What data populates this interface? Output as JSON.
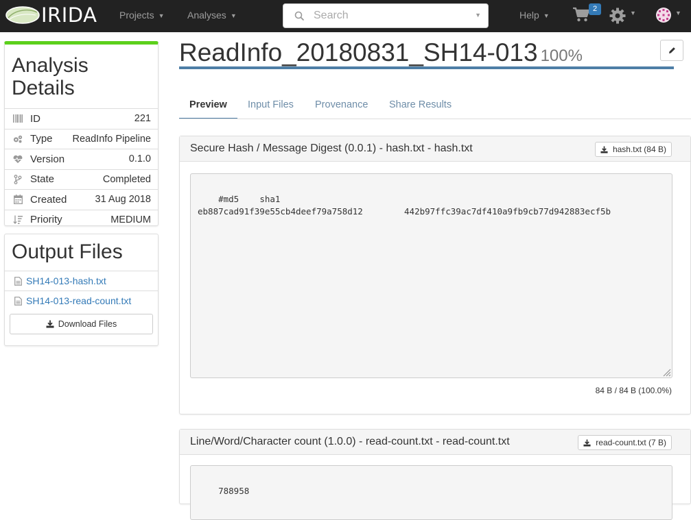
{
  "navbar": {
    "brand": "IRIDA",
    "projects": "Projects",
    "analyses": "Analyses",
    "search_placeholder": "Search",
    "help": "Help",
    "cart_count": "2"
  },
  "details": {
    "title": "Analysis Details",
    "rows": [
      {
        "icon": "barcode-icon",
        "key": "ID",
        "value": "221"
      },
      {
        "icon": "cogs-icon",
        "key": "Type",
        "value": "ReadInfo Pipeline"
      },
      {
        "icon": "heartbeat-icon",
        "key": "Version",
        "value": "0.1.0"
      },
      {
        "icon": "code-branch-icon",
        "key": "State",
        "value": "Completed"
      },
      {
        "icon": "calendar-icon",
        "key": "Created",
        "value": "31 Aug 2018"
      },
      {
        "icon": "sort-amount-icon",
        "key": "Priority",
        "value": "MEDIUM"
      }
    ]
  },
  "outputs": {
    "title": "Output Files",
    "files": [
      "SH14-013-hash.txt",
      "SH14-013-read-count.txt"
    ],
    "download_label": "Download Files"
  },
  "page": {
    "title": "ReadInfo_20180831_SH14-013",
    "percent": "100%"
  },
  "tabs": [
    "Preview",
    "Input Files",
    "Provenance",
    "Share Results"
  ],
  "cards": [
    {
      "title": "Secure Hash / Message Digest (0.0.1) - hash.txt - hash.txt",
      "button": "hash.txt (84 B)",
      "content": "#md5    sha1\neb887cad91f39e55cb4deef79a758d12        442b97ffc39ac7df410a9fb9cb77d942883ecf5b",
      "size": "84 B / 84 B (100.0%)"
    },
    {
      "title": "Line/Word/Character count (1.0.0) - read-count.txt - read-count.txt",
      "button": "read-count.txt (7 B)",
      "content": "788958"
    }
  ],
  "colors": {
    "navbar": "#222222",
    "accent_green": "#5cd01c",
    "link_blue": "#337ab7",
    "title_rule": "#4e7ea6"
  }
}
